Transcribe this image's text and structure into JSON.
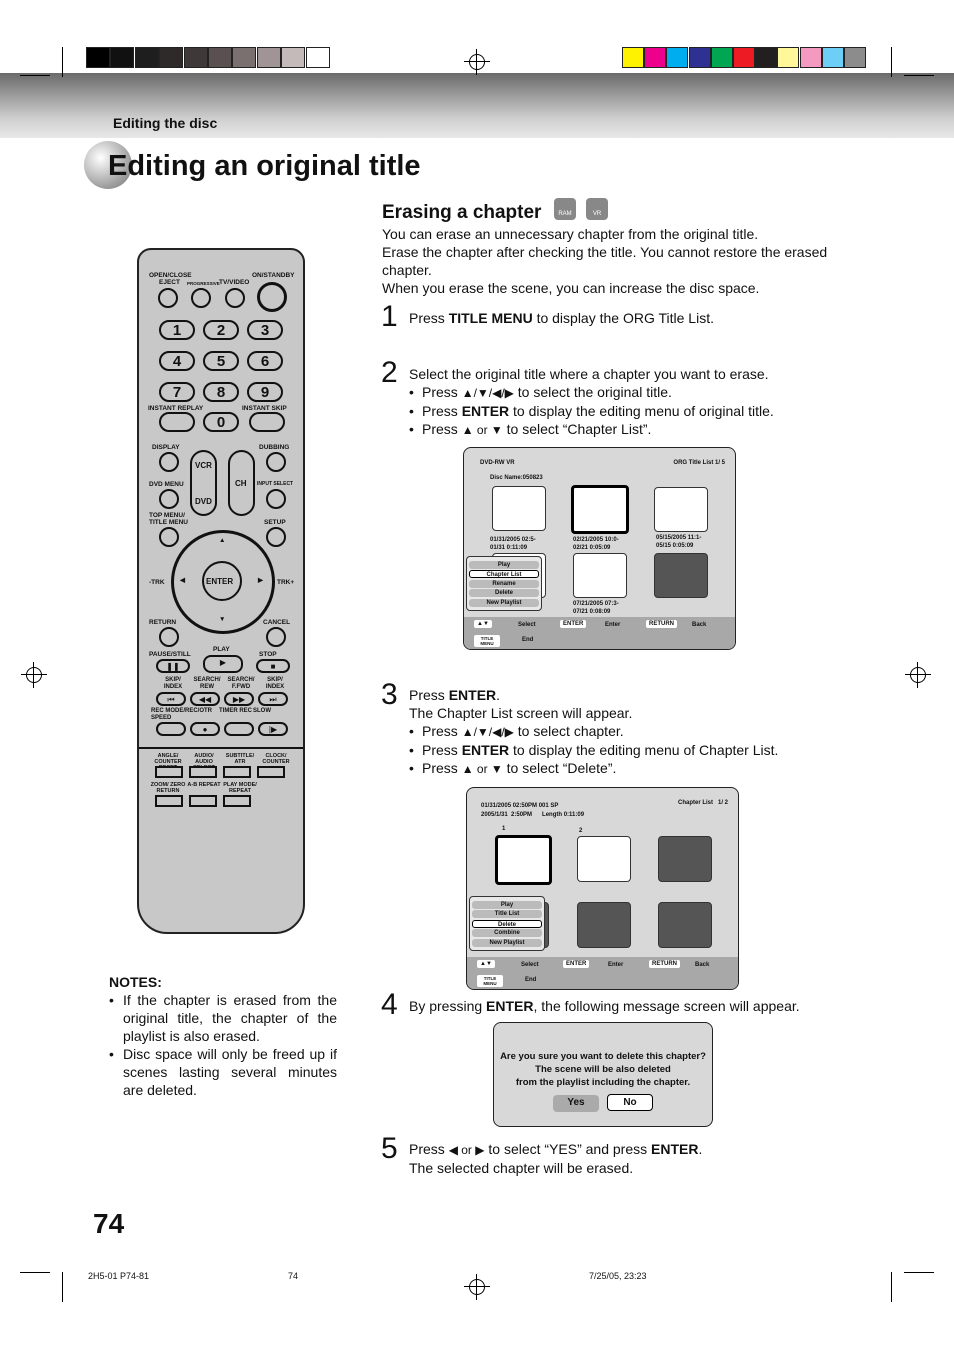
{
  "header": {
    "section": "Editing the disc",
    "title": "Editing an original title"
  },
  "colors": {
    "gray_swatches": [
      "#000000",
      "#111111",
      "#1e1e1e",
      "#2e2a2a",
      "#3e3838",
      "#5a5050",
      "#7a7070",
      "#a09494",
      "#c4baba",
      "#ffffff"
    ],
    "color_swatches": [
      "#fff200",
      "#ec008c",
      "#00aeef",
      "#2e3192",
      "#00a651",
      "#ed1c24",
      "#231f20",
      "#fff799",
      "#f49ac1",
      "#6dcff6",
      "#8c8c8c"
    ]
  },
  "section": {
    "title": "Erasing a chapter",
    "badges": [
      "RAM",
      "VR"
    ],
    "intro": [
      "You can erase an unnecessary chapter from the original title.",
      "Erase the chapter after checking the title. You cannot restore the erased chapter.",
      "When you erase the scene, you can increase the disc space."
    ]
  },
  "steps": [
    {
      "n": "1",
      "pre": "Press ",
      "b": "TITLE MENU",
      "post": " to display the ORG Title List."
    },
    {
      "n": "2",
      "text": "Select the original title where a chapter you want to erase.",
      "bullets": [
        {
          "a": "Press ",
          "arrows": "▲/▼/◀/▶",
          "c": " to select the original title."
        },
        {
          "a": "Press ",
          "b": "ENTER",
          "c": " to display the editing menu of original title."
        },
        {
          "a": "Press ",
          "arrows": "▲ or ▼",
          "c": " to select “Chapter List”."
        }
      ]
    },
    {
      "n": "3",
      "pre": "Press ",
      "b": "ENTER",
      "post": ".",
      "text": "The Chapter List screen will appear.",
      "bullets": [
        {
          "a": "Press ",
          "arrows": "▲/▼/◀/▶",
          "c": " to select chapter."
        },
        {
          "a": "Press ",
          "b": "ENTER",
          "c": " to display the editing menu of Chapter List."
        },
        {
          "a": "Press ",
          "arrows": "▲ or ▼",
          "c": " to select “Delete”."
        }
      ]
    },
    {
      "n": "4",
      "pre": "By pressing ",
      "b": "ENTER",
      "post": ", the following message screen will appear."
    },
    {
      "n": "5",
      "pre": "Press ",
      "arrows": "◀ or ▶",
      "mid": " to select “YES” and press ",
      "b": "ENTER",
      "post": ".",
      "text": "The selected chapter will be erased."
    }
  ],
  "screen1": {
    "disc": "DVD-RW VR",
    "list": "ORG Title List  1/ 5",
    "disc_name": "Disc Name:050823",
    "thumbs": [
      [
        "01/31/2005 02:5-",
        "01/31 0:11:09"
      ],
      [
        "02/21/2005 10:0-",
        "02/21 0:05:09"
      ],
      [
        "05/15/2005 11:1-",
        "05/15 0:05:09"
      ],
      [
        "07/21/2005 07:3-",
        "07/21 0:08:09"
      ]
    ],
    "menu": [
      "Play",
      "Chapter List",
      "Rename",
      "Delete",
      "New Playlist"
    ],
    "selected": 1
  },
  "screen2": {
    "line1": "01/31/2005 02:50PM 001 SP",
    "line2": "2005/1/31  2:50PM      Length 0:11:09",
    "list": "Chapter List   1/ 2",
    "ch": [
      "1",
      "2"
    ],
    "menu": [
      "Play",
      "Title List",
      "Delete",
      "Combine",
      "New Playlist"
    ],
    "selected": 2
  },
  "footer_keys": {
    "updown": "▲▼",
    "select": "Select",
    "enter_key": "ENTER",
    "enter": "Enter",
    "return_key": "RETURN",
    "back": "Back",
    "title_menu": "TITLE MENU",
    "end": "End"
  },
  "dialog": {
    "lines": [
      "Are you sure you want to delete this chapter?",
      "The scene will be also deleted",
      "from the playlist including the chapter."
    ],
    "yes": "Yes",
    "no": "No"
  },
  "remote": {
    "labels": {
      "open": "OPEN/CLOSE",
      "eject": "EJECT",
      "prog": "PROGRESSIVE",
      "tv": "TV/VIDEO",
      "on": "ON/STANDBY",
      "ireplay": "INSTANT REPLAY",
      "iskip": "INSTANT SKIP",
      "display": "DISPLAY",
      "dubbing": "DUBBING",
      "vcr": "VCR",
      "dvd": "DVD",
      "ch": "CH",
      "dvdmenu": "DVD MENU",
      "input": "INPUT SELECT",
      "topmenu": "TOP MENU/",
      "titlemenu": "TITLE MENU",
      "setup": "SETUP",
      "trkm": "-TRK",
      "trkp": "TRK+",
      "enter": "ENTER",
      "return": "RETURN",
      "cancel": "CANCEL",
      "pause": "PAUSE/STILL",
      "play": "PLAY",
      "stop": "STOP",
      "skipb": "SKIP/ INDEX",
      "rew": "SEARCH/ REW",
      "ffwd": "SEARCH/ F.FWD",
      "skipf": "SKIP/ INDEX",
      "recmode": "REC MODE/ SPEED",
      "recotr": "REC/OTR",
      "timer": "TIMER REC",
      "slow": "SLOW",
      "angle": "ANGLE/ COUNTER RESET",
      "audio": "AUDIO/ AUDIO SELECT",
      "subtitle": "SUBTITLE/ ATR",
      "clock": "CLOCK/ COUNTER",
      "zoom": "ZOOM/ ZERO RETURN",
      "ab": "A-B REPEAT",
      "playmode": "PLAY MODE/ REPEAT"
    },
    "digits": [
      "1",
      "2",
      "3",
      "4",
      "5",
      "6",
      "7",
      "8",
      "9",
      "0"
    ]
  },
  "notes": {
    "title": "NOTES:",
    "items": [
      "If the chapter is erased from the original title, the chapter of the playlist is also erased.",
      "Disc space will only be freed up if scenes lasting several minutes are deleted."
    ]
  },
  "page_number": "74",
  "print_footer": {
    "code": "2H5-01 P74-81",
    "page": "74",
    "date": "7/25/05, 23:23"
  }
}
